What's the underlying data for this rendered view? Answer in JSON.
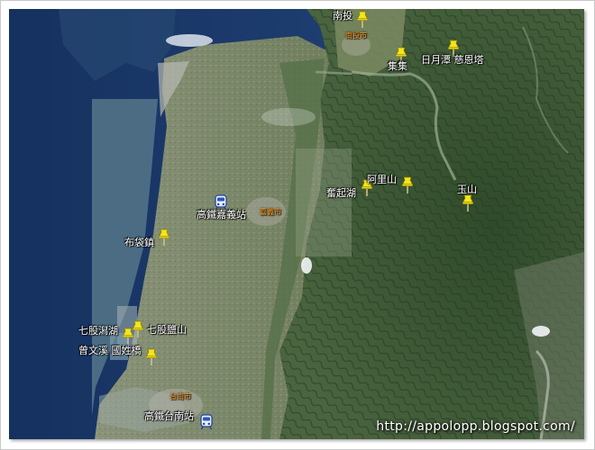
{
  "map": {
    "type": "satellite",
    "colors": {
      "sea_deep": "#1c3a6b",
      "sea_shallow": "#5d8293",
      "plain": "#7d8a69",
      "mountain": "#3d5735",
      "pin": "#f3e51d",
      "city_label": "#ff9a1e"
    }
  },
  "places": [
    {
      "name": "南投",
      "icon": "pushpin-icon"
    },
    {
      "name": "集集",
      "icon": "pushpin-icon"
    },
    {
      "name": "日月潭 慈恩塔",
      "icon": "pushpin-icon"
    },
    {
      "name": "阿里山",
      "icon": "pushpin-icon"
    },
    {
      "name": "奮起湖",
      "icon": "pushpin-icon"
    },
    {
      "name": "玉山",
      "icon": "pushpin-icon"
    },
    {
      "name": "布袋鎮",
      "icon": "pushpin-icon"
    },
    {
      "name": "七股潟湖",
      "icon": "pushpin-icon"
    },
    {
      "name": "七股鹽山",
      "icon": "pushpin-icon"
    },
    {
      "name": "曾文溪 國姓橋",
      "icon": "pushpin-icon"
    }
  ],
  "stations": [
    {
      "name": "高鐵嘉義站",
      "icon": "train-icon"
    },
    {
      "name": "高鐵台南站",
      "icon": "train-icon"
    }
  ],
  "cities": [
    "南投市",
    "嘉義市",
    "台南市"
  ],
  "watermark": "http://appolopp.blogspot.com/"
}
